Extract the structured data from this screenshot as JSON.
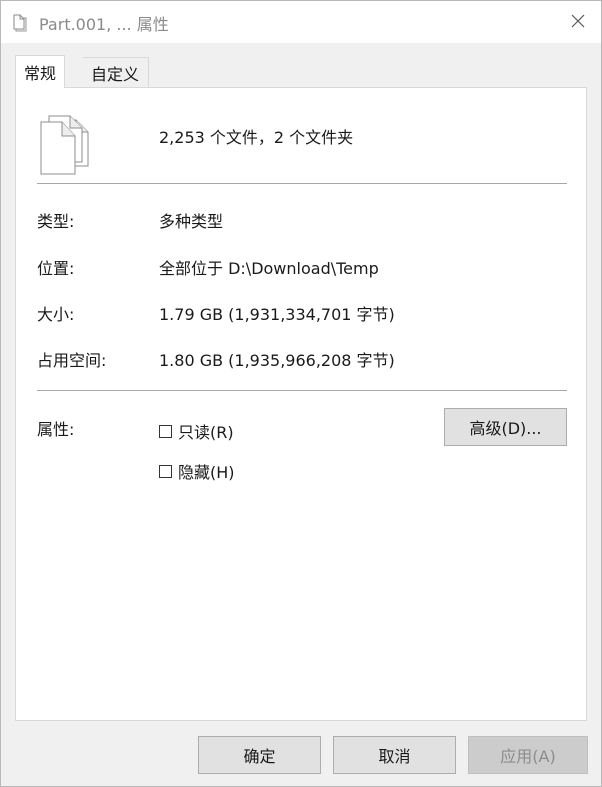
{
  "window": {
    "title": "Part.001, ... 属性"
  },
  "tabs": [
    {
      "label": "常规",
      "active": true
    },
    {
      "label": "自定义",
      "active": false
    }
  ],
  "general": {
    "summary": "2,253 个文件，2 个文件夹",
    "icon": "multiple-files-icon",
    "rows": [
      {
        "label": "类型:",
        "value": "多种类型"
      },
      {
        "label": "位置:",
        "value": "全部位于 D:\\Download\\Temp"
      },
      {
        "label": "大小:",
        "value": "1.79 GB (1,931,334,701 字节)"
      },
      {
        "label": "占用空间:",
        "value": "1.80 GB (1,935,966,208 字节)"
      }
    ],
    "attributes": {
      "label": "属性:",
      "checkboxes": [
        {
          "label": "只读(R)",
          "checked": false
        },
        {
          "label": "隐藏(H)",
          "checked": false
        }
      ],
      "advanced_button": "高级(D)..."
    }
  },
  "footer": {
    "ok": "确定",
    "cancel": "取消",
    "apply": "应用(A)"
  },
  "colors": {
    "window_bg": "#f0f0f0",
    "panel_bg": "#ffffff",
    "button_bg": "#e1e1e1",
    "title_text": "#8a8a8a"
  }
}
